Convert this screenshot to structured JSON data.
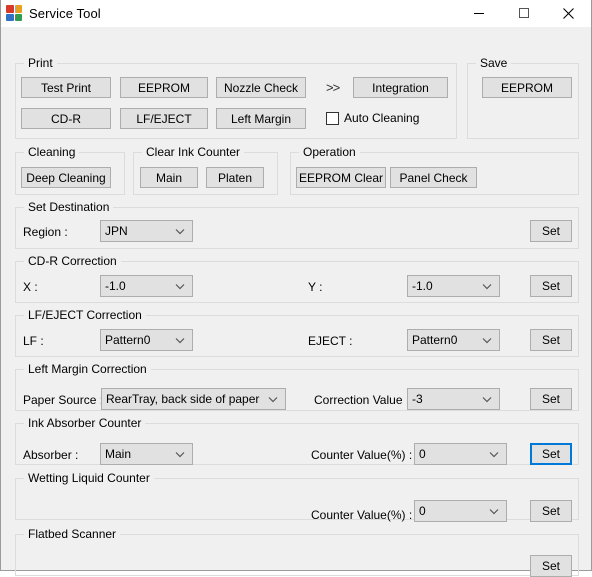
{
  "window": {
    "title": "Service Tool",
    "icon": "app-blocks-icon",
    "controls": {
      "minimize": "minimize-icon",
      "maximize": "maximize-icon",
      "close": "close-icon"
    }
  },
  "colors": {
    "window_bg": "#f0f0f0",
    "button_face": "#e1e1e1",
    "button_border": "#adadad",
    "group_border": "#dcdcdc",
    "focus_blue": "#0078d7"
  },
  "groups": {
    "print": {
      "legend": "Print",
      "buttons": [
        {
          "label": "Test Print"
        },
        {
          "label": "EEPROM"
        },
        {
          "label": "Nozzle Check"
        },
        {
          "label": "CD-R"
        },
        {
          "label": "LF/EJECT"
        },
        {
          "label": "Left Margin"
        },
        {
          "label": "Integration"
        }
      ],
      "arrows": ">>",
      "checkbox": {
        "label": "Auto Cleaning",
        "checked": false
      }
    },
    "save": {
      "legend": "Save",
      "button": "EEPROM"
    },
    "cleaning": {
      "legend": "Cleaning",
      "button": "Deep Cleaning"
    },
    "clear_ink_counter": {
      "legend": "Clear Ink Counter",
      "buttons": [
        {
          "label": "Main"
        },
        {
          "label": "Platen"
        }
      ]
    },
    "operation": {
      "legend": "Operation",
      "buttons": [
        {
          "label": "EEPROM Clear"
        },
        {
          "label": "Panel Check"
        }
      ]
    },
    "set_destination": {
      "legend": "Set Destination",
      "region_label": "Region :",
      "region_value": "JPN",
      "set_label": "Set"
    },
    "cdr_correction": {
      "legend": "CD-R Correction",
      "x_label": "X :",
      "x_value": "-1.0",
      "y_label": "Y :",
      "y_value": "-1.0",
      "set_label": "Set"
    },
    "lf_eject_correction": {
      "legend": "LF/EJECT Correction",
      "lf_label": "LF :",
      "lf_value": "Pattern0",
      "eject_label": "EJECT :",
      "eject_value": "Pattern0",
      "set_label": "Set"
    },
    "left_margin_correction": {
      "legend": "Left Margin Correction",
      "paper_source_label": "Paper Source :",
      "paper_source_value": "RearTray, back side of paper",
      "correction_value_label": "Correction Value :",
      "correction_value": "-3",
      "set_label": "Set"
    },
    "ink_absorber_counter": {
      "legend": "Ink Absorber Counter",
      "absorber_label": "Absorber :",
      "absorber_value": "Main",
      "counter_label": "Counter Value(%) :",
      "counter_value": "0",
      "set_label": "Set",
      "set_focused": true
    },
    "wetting_liquid_counter": {
      "legend": "Wetting Liquid Counter",
      "counter_label": "Counter Value(%) :",
      "counter_value": "0",
      "set_label": "Set"
    },
    "flatbed_scanner": {
      "legend": "Flatbed Scanner",
      "set_label": "Set"
    }
  }
}
